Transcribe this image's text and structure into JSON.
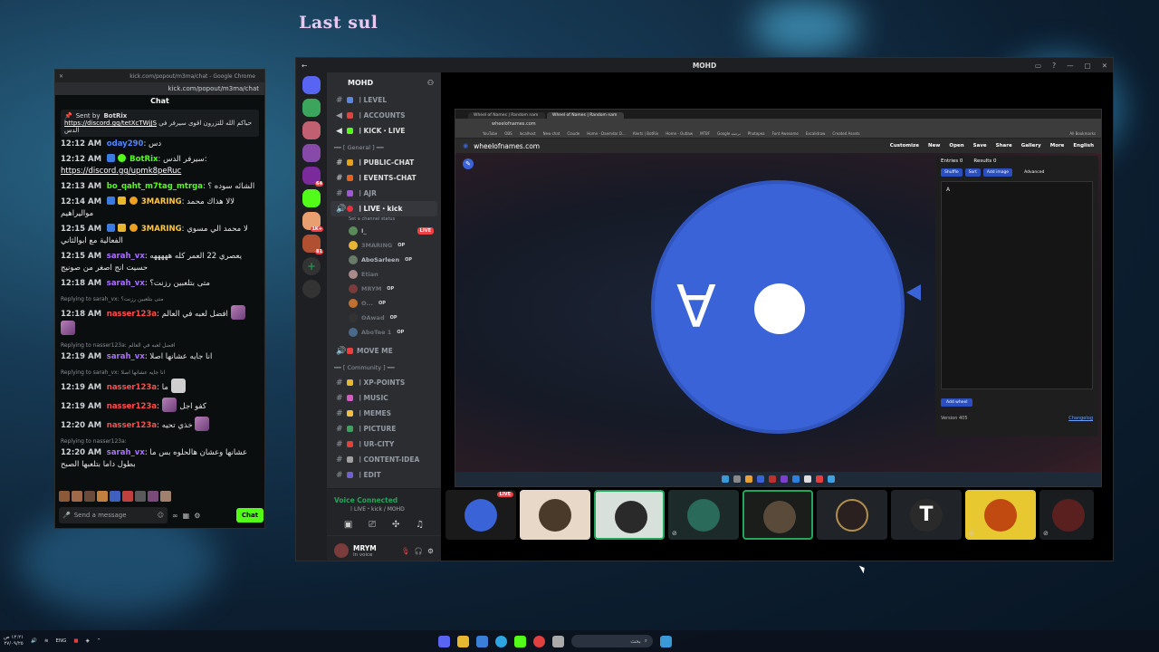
{
  "overlay": {
    "title": "Last sul"
  },
  "chat_window": {
    "tab_url": "kick.com/popout/m3ma/chat - Google Chrome",
    "url": "kick.com/popout/m3ma/chat",
    "header": "Chat",
    "pinned": {
      "sender_label": "Sent by",
      "sender": "BotRix",
      "text": "حياكم الله للتزرون اقوى سيرفر في الدس",
      "link": "https://discord.gg/tetXcTWjJS"
    },
    "messages": [
      {
        "time": "12:12 AM",
        "user": "oday290",
        "user_color": "#4f86ff",
        "text": "دس"
      },
      {
        "time": "12:12 AM",
        "user": "BotRix",
        "user_color": "#53fc18",
        "text": "سيرفر الدس:",
        "link": "https://discord.gg/upmk8peRuc"
      },
      {
        "time": "12:13 AM",
        "user": "bo_qaht_m7tag_mtrga",
        "user_color": "#53fc18",
        "text": "الشائه سوده ؟"
      },
      {
        "time": "12:14 AM",
        "user": "3MARING",
        "user_color": "#ffc83d",
        "text": "لالا هذاك محمد مواليراهيم"
      },
      {
        "time": "12:15 AM",
        "user": "3MARING",
        "user_color": "#ffc83d",
        "text": "لا محمد الي مسوي الفعالية مع ابوالثاني"
      },
      {
        "time": "12:15 AM",
        "user": "sarah_vx",
        "user_color": "#a970ff",
        "text": "يعصري 22 العمر كله هههههه حسيت انج اصغر من صونيج"
      },
      {
        "time": "12:18 AM",
        "user": "sarah_vx",
        "user_color": "#a970ff",
        "text": "متى بتلعبين رزنت؟"
      },
      {
        "time": "12:18 AM",
        "user": "nasser123a",
        "user_color": "#ff4d4d",
        "text": "افضل لعبه في العالم",
        "reply": "Replying to sarah_vx: متى بتلعبين رزنت؟"
      },
      {
        "time": "12:19 AM",
        "user": "sarah_vx",
        "user_color": "#a970ff",
        "text": "انا جايه عشانها اصلا",
        "reply": "Replying to nasser123a: افضل لعبه في العالم"
      },
      {
        "time": "12:19 AM",
        "user": "nasser123a",
        "user_color": "#ff4d4d",
        "text": "ما",
        "reply": "Replying to sarah_vx: انا جايه عشانها اصلا"
      },
      {
        "time": "12:19 AM",
        "user": "nasser123a",
        "user_color": "#ff4d4d",
        "text": "كفو اجل"
      },
      {
        "time": "12:20 AM",
        "user": "nasser123a",
        "user_color": "#ff4d4d",
        "text": "خذي تحيه"
      },
      {
        "time": "12:20 AM",
        "user": "sarah_vx",
        "user_color": "#a970ff",
        "text": "عشانها وعشان هالحلوه بس ما بطول داما بتلعبها الصبح",
        "reply": "Replying to nasser123a:"
      }
    ],
    "input_placeholder": "Send a message",
    "chat_button": "Chat"
  },
  "discord": {
    "window_title": "MOHD",
    "server_name": "MOHD",
    "channels_top": [
      {
        "name": "〡LEVEL",
        "type": "text"
      },
      {
        "name": "〡ACCOUNTS",
        "type": "announce"
      },
      {
        "name": "〡KICK・LIVE",
        "type": "announce"
      }
    ],
    "category_general": "━━ [ General ] ━━",
    "channels_general": [
      {
        "name": "〡PUBLIC-CHAT"
      },
      {
        "name": "〡EVENTS-CHAT"
      },
      {
        "name": "〡AJR"
      }
    ],
    "voice_channel": {
      "name": "〡LIVE・kick",
      "status": "Set a channel status",
      "live": "LIVE"
    },
    "voice_users": [
      {
        "name": "I_",
        "op": "",
        "dim": false
      },
      {
        "name": "3MARING",
        "op": "OP",
        "dim": true
      },
      {
        "name": "AboSarleen",
        "op": "OP",
        "dim": false
      },
      {
        "name": "Etian",
        "op": "",
        "dim": true
      },
      {
        "name": "MRYM",
        "op": "OP",
        "dim": true
      },
      {
        "name": "ʘ...",
        "op": "OP",
        "dim": true
      },
      {
        "name": "ʘAwad",
        "op": "OP",
        "dim": true
      },
      {
        "name": "AboTee 1",
        "op": "OP",
        "dim": true
      }
    ],
    "move_me": "MOVE ME",
    "category_community": "━━ [ Community ] ━━",
    "channels_community": [
      {
        "name": "〡XP-POINTS"
      },
      {
        "name": "〡MUSIC"
      },
      {
        "name": "〡MEMES"
      },
      {
        "name": "〡PICTURE"
      },
      {
        "name": "〡UR-CITY"
      },
      {
        "name": "〡CONTENT-IDEA"
      },
      {
        "name": "〡EDIT"
      }
    ],
    "voice_connected": "Voice Connected",
    "voice_sub": "〡LIVE・kick / MOHD",
    "user": {
      "name": "MRYM",
      "status": "In voice"
    },
    "server_badges": [
      "64",
      "1K+",
      "81"
    ]
  },
  "stream": {
    "tabs": [
      "Wheel of Names | Random nam",
      "Wheel of Names | Random nam"
    ],
    "url": "wheelofnames.com",
    "bookmarks": [
      "YouTube",
      "OBS",
      "localhost",
      "New chat",
      "Claude",
      "Home - Daemdar D...",
      "Alerts | BotRix",
      "Home - Outlaw",
      "MTBF",
      "Google ترجمة",
      "Photopea",
      "Font Awesome",
      "Excalidraw",
      "Created Assets",
      "All Bookmarks"
    ],
    "site_name": "wheelofnames.com",
    "menu": [
      "Customize",
      "New",
      "Open",
      "Save",
      "Share",
      "Gallery",
      "More",
      "English"
    ],
    "wheel_letter": "A",
    "entries_tab": "Entries",
    "entries_count": "0",
    "results_tab": "Results",
    "results_count": "0",
    "entry_buttons": [
      "Shuffle",
      "Sort",
      "Add image"
    ],
    "advanced": "Advanced",
    "entry_text": "A",
    "add_wheel": "Add wheel",
    "version": "Version 405",
    "changelog": "Changelog",
    "live_label": "LIVE"
  },
  "taskbar": {
    "time": "١٢:٢١ ص",
    "date": "٢٧/٠٩/٢٥",
    "lang": "ENG",
    "search_placeholder": "بحث"
  }
}
